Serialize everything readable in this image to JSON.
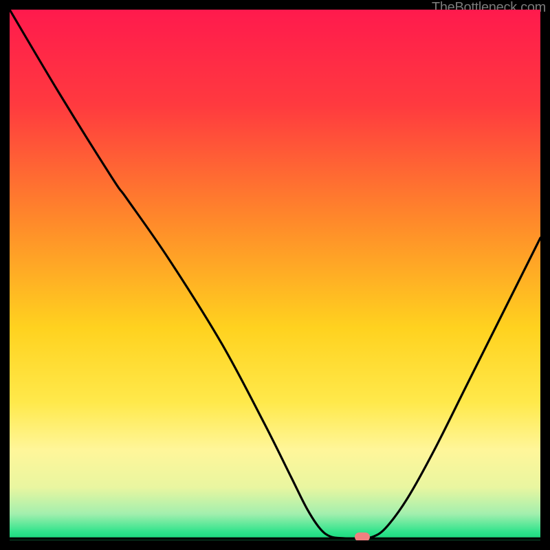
{
  "attribution": "TheBottleneck.com",
  "chart_data": {
    "type": "line",
    "title": "",
    "xlabel": "",
    "ylabel": "",
    "xlim": [
      0,
      100
    ],
    "ylim": [
      0,
      100
    ],
    "gradient_stops": [
      {
        "offset": 0,
        "color": "#ff1a4d"
      },
      {
        "offset": 0.18,
        "color": "#ff3a3f"
      },
      {
        "offset": 0.4,
        "color": "#ff8a2a"
      },
      {
        "offset": 0.6,
        "color": "#ffd21f"
      },
      {
        "offset": 0.74,
        "color": "#ffe94b"
      },
      {
        "offset": 0.83,
        "color": "#fff69a"
      },
      {
        "offset": 0.9,
        "color": "#e9f6a0"
      },
      {
        "offset": 0.95,
        "color": "#a3efae"
      },
      {
        "offset": 0.985,
        "color": "#2de38b"
      },
      {
        "offset": 1.0,
        "color": "#17d67b"
      }
    ],
    "curve_points": [
      {
        "x": 0.0,
        "y": 100.0
      },
      {
        "x": 9.5,
        "y": 84.0
      },
      {
        "x": 19.5,
        "y": 68.0
      },
      {
        "x": 22.0,
        "y": 64.5
      },
      {
        "x": 30.0,
        "y": 53.0
      },
      {
        "x": 40.0,
        "y": 37.0
      },
      {
        "x": 48.0,
        "y": 22.0
      },
      {
        "x": 53.0,
        "y": 12.0
      },
      {
        "x": 56.0,
        "y": 6.0
      },
      {
        "x": 58.5,
        "y": 2.2
      },
      {
        "x": 60.5,
        "y": 0.7
      },
      {
        "x": 63.0,
        "y": 0.4
      },
      {
        "x": 66.0,
        "y": 0.4
      },
      {
        "x": 68.5,
        "y": 0.7
      },
      {
        "x": 71.0,
        "y": 2.5
      },
      {
        "x": 75.0,
        "y": 8.0
      },
      {
        "x": 80.0,
        "y": 17.0
      },
      {
        "x": 86.0,
        "y": 29.0
      },
      {
        "x": 92.0,
        "y": 41.0
      },
      {
        "x": 100.0,
        "y": 57.0
      }
    ],
    "marker": {
      "x": 66.5,
      "y": 0.6
    },
    "axis_line": {
      "color": "#000000",
      "y": 0.3
    }
  }
}
